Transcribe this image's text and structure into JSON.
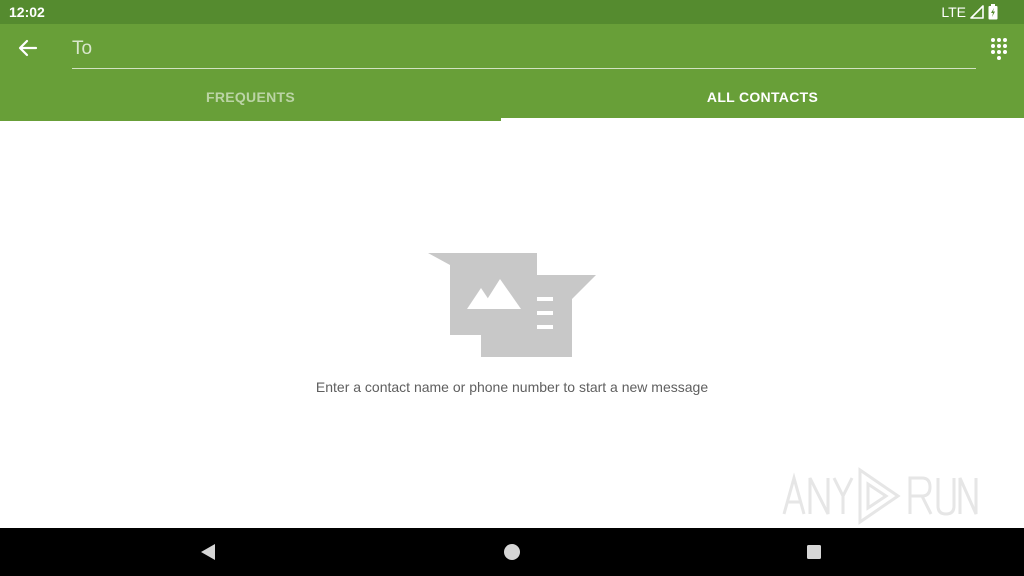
{
  "status_bar": {
    "time": "12:02",
    "network": "LTE",
    "icons": [
      "signal-icon",
      "battery-charging-icon"
    ]
  },
  "app_bar": {
    "back_icon": "arrow-back-icon",
    "recipient_placeholder": "To",
    "recipient_value": "",
    "dialpad_icon": "dialpad-icon",
    "tabs": [
      {
        "label": "FREQUENTS",
        "selected": false
      },
      {
        "label": "ALL CONTACTS",
        "selected": true
      }
    ]
  },
  "content": {
    "illustration_icon": "new-message-empty-icon",
    "empty_message": "Enter a contact name or phone number to start a new message"
  },
  "watermark": {
    "text": "ANY RUN"
  },
  "nav_bar": {
    "buttons": [
      "back-triangle-icon",
      "home-circle-icon",
      "recents-square-icon"
    ]
  },
  "colors": {
    "status_bar": "#558b2f",
    "app_bar": "#689f38",
    "illustration": "#c8c8c8",
    "text_secondary": "#5f5f5f"
  }
}
